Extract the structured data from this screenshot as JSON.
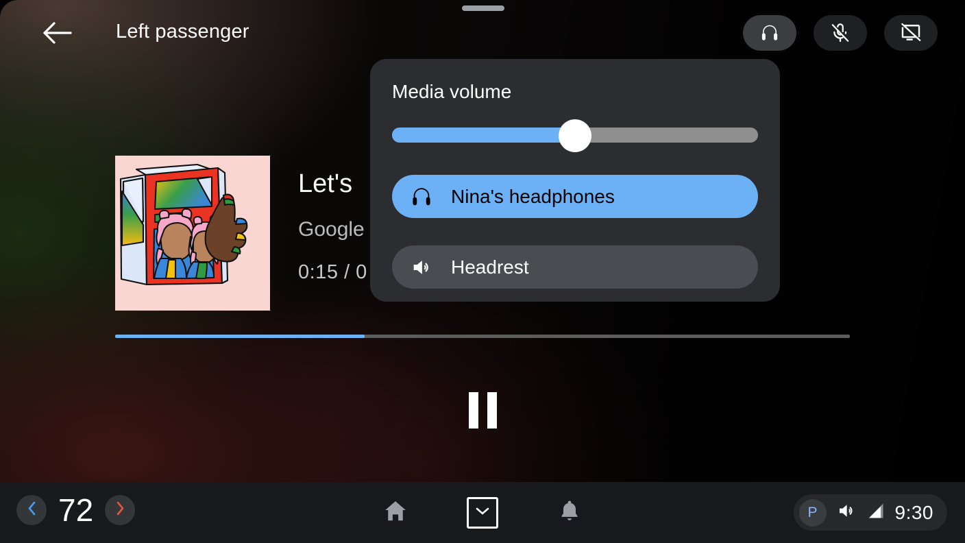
{
  "window": {
    "drag_handle": "drag-handle"
  },
  "topbar": {
    "back_icon": "arrow-left-icon",
    "title": "Left passenger",
    "actions": [
      {
        "name": "headphones-toggle",
        "icon": "headphones-icon",
        "active": true
      },
      {
        "name": "microphone-mute-toggle",
        "icon": "mic-off-icon",
        "active": false
      },
      {
        "name": "screen-off-toggle",
        "icon": "screen-off-icon",
        "active": false
      }
    ]
  },
  "now_playing": {
    "album_art_alt": "album-art-two-women-magazine",
    "title": "Let's",
    "artist": "Google",
    "time": "0:15 / 0",
    "progress_percent": 34,
    "transport": {
      "pause_icon": "pause-icon",
      "state": "playing"
    }
  },
  "volume_popup": {
    "title": "Media volume",
    "slider": {
      "name": "media-volume-slider",
      "value_percent": 50
    },
    "devices": [
      {
        "label": "Nina's headphones",
        "icon": "headphones-icon",
        "selected": true
      },
      {
        "label": "Headrest",
        "icon": "speaker-volume-icon",
        "selected": false
      }
    ]
  },
  "navbar": {
    "climate": {
      "decrease_icon": "chevron-left-icon",
      "temperature": "72",
      "increase_icon": "chevron-right-icon"
    },
    "center_icons": [
      {
        "name": "home-icon",
        "label": "home"
      },
      {
        "name": "chevron-down-icon",
        "label": "collapse"
      },
      {
        "name": "bell-icon",
        "label": "notifications"
      }
    ],
    "status": {
      "profile_initial": "P",
      "volume_icon": "speaker-volume-icon",
      "signal_icon": "signal-bars-icon",
      "clock": "9:30"
    }
  },
  "colors": {
    "accent_blue": "#6cb0f5",
    "panel_bg": "#2b2d30",
    "navbar_bg": "#17191c",
    "cool_blue": "#4a9cf0",
    "warm_red": "#e8553d",
    "album_bg": "#f9d6d2"
  }
}
